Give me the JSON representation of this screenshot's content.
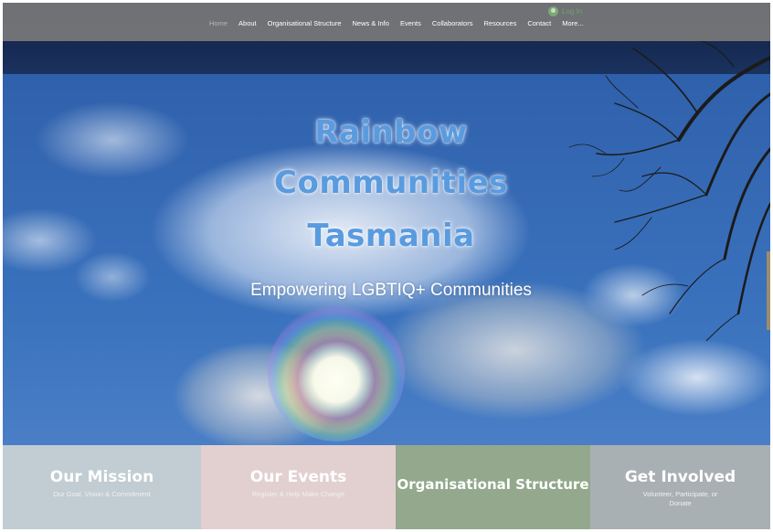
{
  "header": {
    "login_label": "Log In",
    "nav": [
      {
        "label": "Home",
        "active": true
      },
      {
        "label": "About"
      },
      {
        "label": "Organisational Structure"
      },
      {
        "label": "News & Info"
      },
      {
        "label": "Events"
      },
      {
        "label": "Collaborators"
      },
      {
        "label": "Resources"
      },
      {
        "label": "Contact"
      },
      {
        "label": "More..."
      }
    ]
  },
  "hero": {
    "title_line1": "Rainbow",
    "title_line2": "Communities",
    "title_line3": "Tasmania",
    "subtitle": "Empowering LGBTIQ+ Communities"
  },
  "tiles": [
    {
      "title": "Our Mission",
      "desc": "Our Goal, Vision & Commitment",
      "color": "#c1cdd3"
    },
    {
      "title": "Our Events",
      "desc": "Register & Help Make Change",
      "color": "#e2d0d1"
    },
    {
      "title": "Organisational Structure",
      "desc": "",
      "color": "#93a88c"
    },
    {
      "title": "Get Involved",
      "desc": "Volunteer, Participate, or Donate",
      "color": "#a9b0b4"
    }
  ],
  "colors": {
    "title_blue": "#5a9be0",
    "nav_bar": "#787878",
    "login_green": "#6fa06a"
  }
}
